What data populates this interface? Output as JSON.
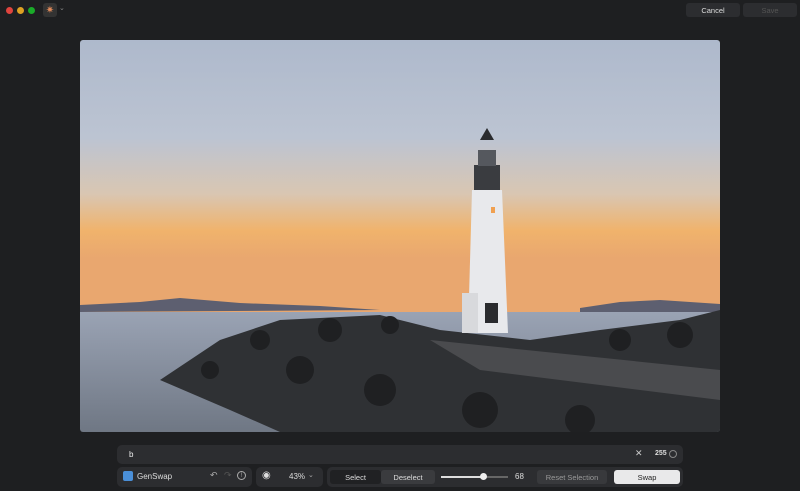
{
  "window": {
    "traffic_lights": [
      "#e0443e",
      "#dea123",
      "#1aab29"
    ]
  },
  "header": {
    "cancel_label": "Cancel",
    "save_label": "Save"
  },
  "prompt": {
    "value": "b",
    "char_count": "255"
  },
  "toolbar": {
    "tool_name": "GenSwap",
    "zoom": "43%",
    "select_label": "Select",
    "deselect_label": "Deselect",
    "brush_size": "68",
    "brush_fraction": 0.63,
    "reset_label": "Reset Selection",
    "swap_label": "Swap"
  }
}
